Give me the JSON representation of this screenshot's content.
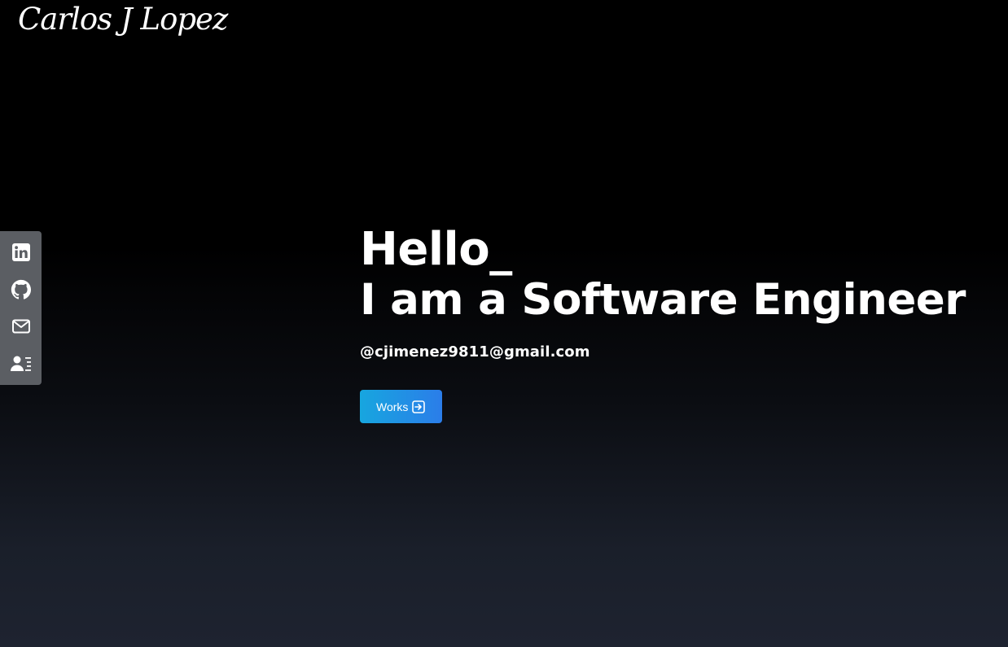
{
  "header": {
    "logo_text": "Carlos J Lopez"
  },
  "social": {
    "items": [
      {
        "name": "linkedin",
        "icon": "linkedin-icon"
      },
      {
        "name": "github",
        "icon": "github-icon"
      },
      {
        "name": "email",
        "icon": "mail-icon"
      },
      {
        "name": "contact",
        "icon": "contact-card-icon"
      }
    ],
    "bar_color": "#5b5e63"
  },
  "hero": {
    "greeting": "Hello_",
    "headline": "I am a Software Engineer",
    "email": "@cjimenez9811@gmail.com",
    "works_button_label": "Works",
    "works_button_icon": "arrow-right-square-icon"
  },
  "colors": {
    "button_gradient_start": "#17a6df",
    "button_gradient_end": "#2b7de9",
    "background_top": "#000000",
    "background_bottom": "#1e2330"
  }
}
